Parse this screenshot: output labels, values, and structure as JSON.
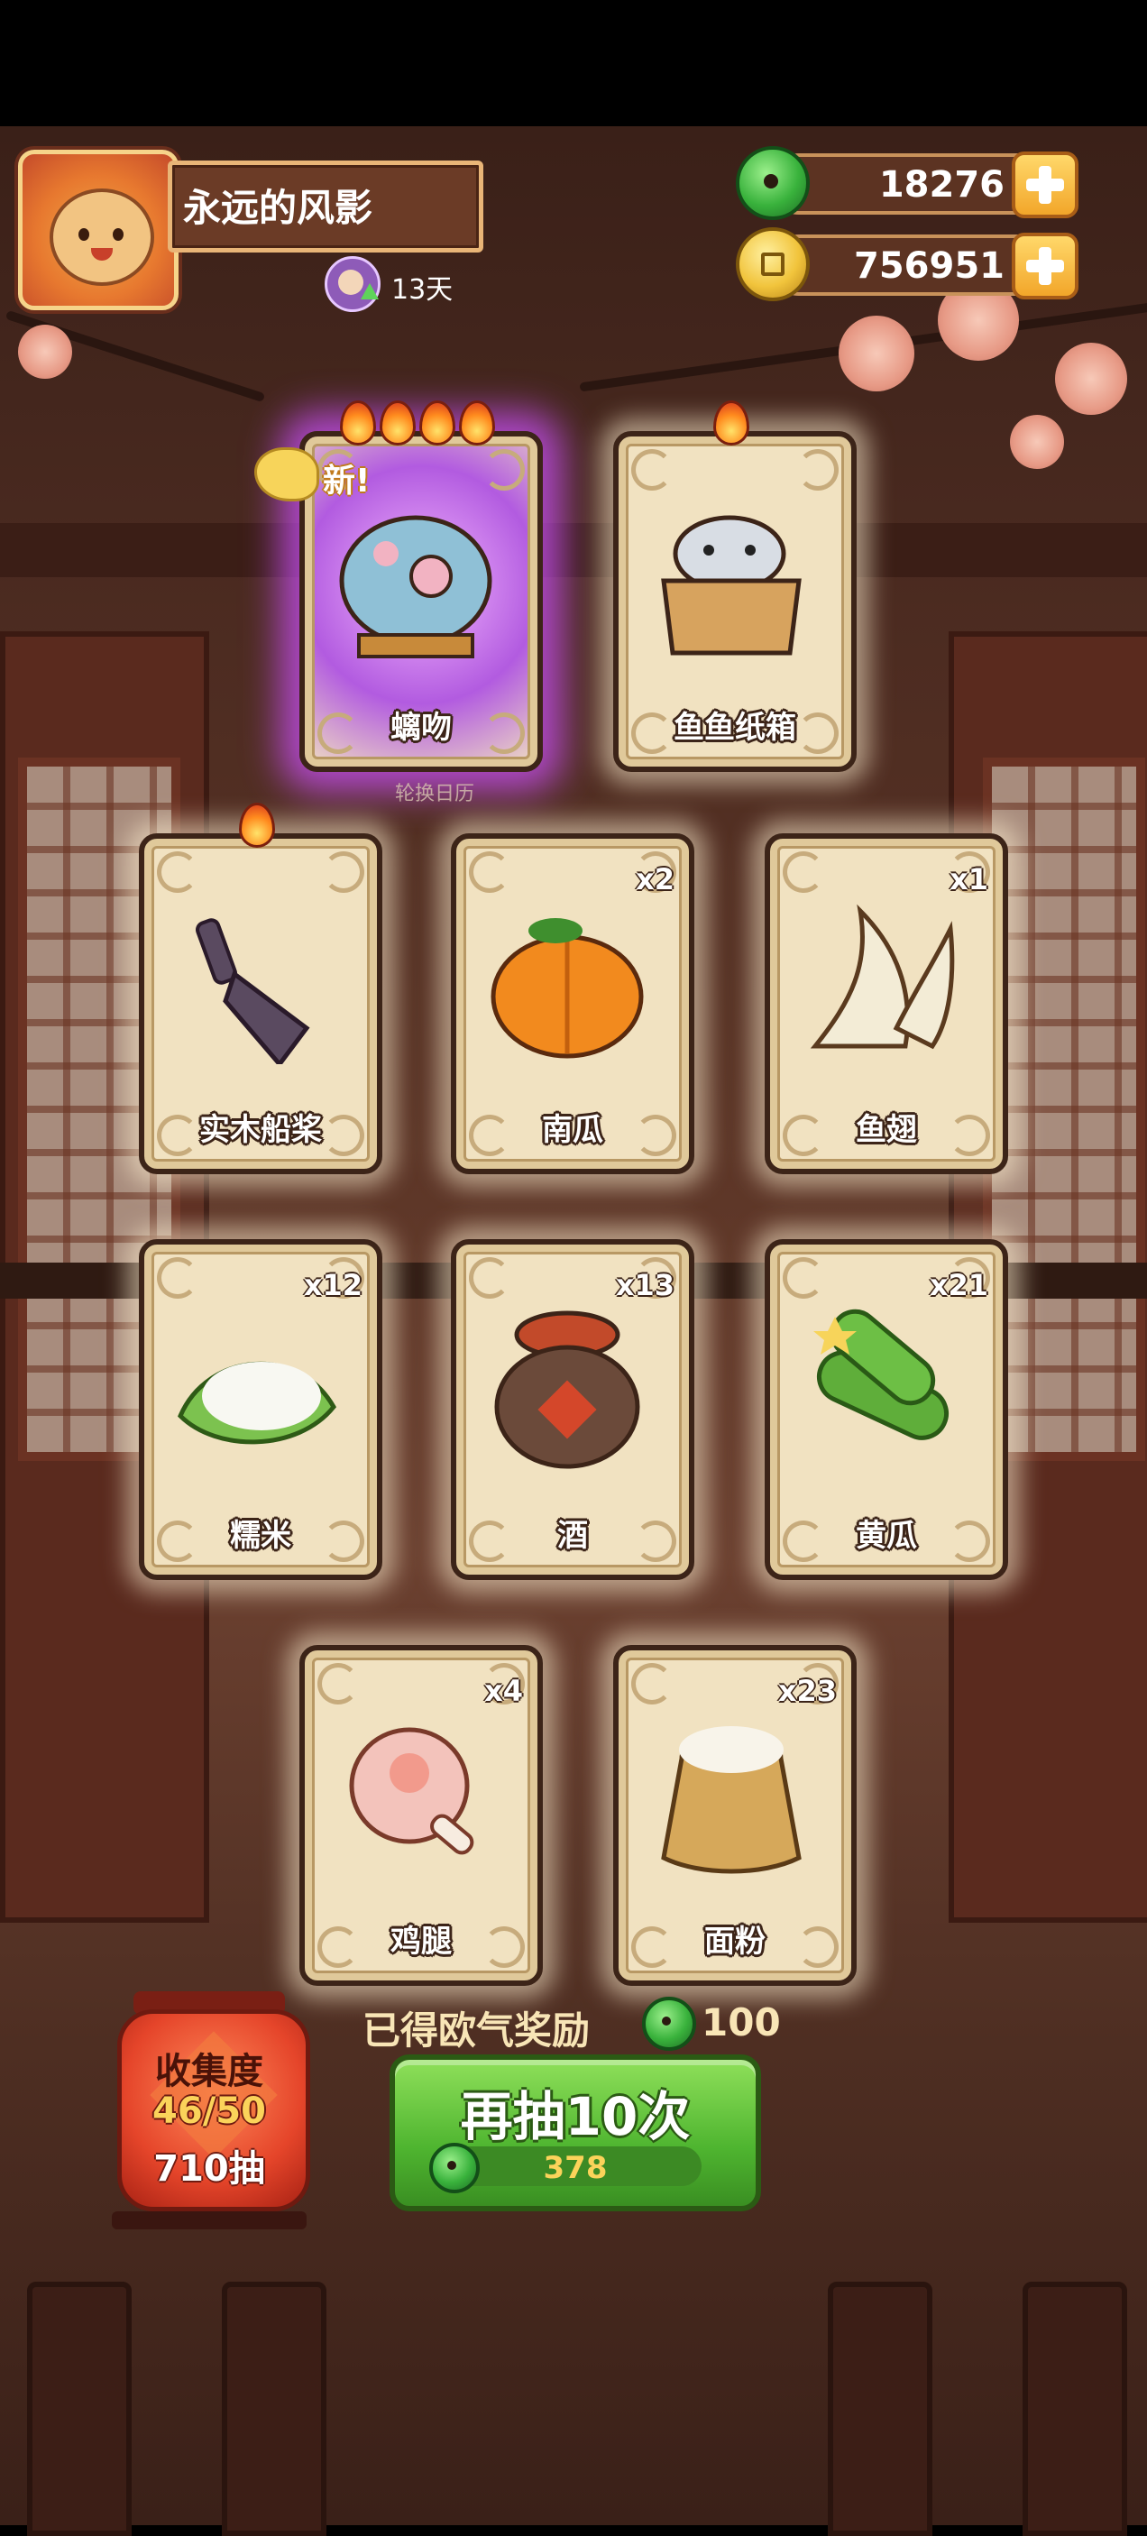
{
  "player": {
    "name": "永远的风影",
    "days": "13天"
  },
  "currency": {
    "jade": "18276",
    "gold": "756951"
  },
  "badges": {
    "new": "新!"
  },
  "calendar_label": "轮换日历",
  "cards": [
    {
      "name": "螭吻",
      "qty": "",
      "flames": 4,
      "rare": true,
      "art": "dragon-fish-icon"
    },
    {
      "name": "鱼鱼纸箱",
      "qty": "",
      "flames": 1,
      "rare": false,
      "art": "seal-in-box-icon"
    },
    {
      "name": "实木船桨",
      "qty": "",
      "flames": 1,
      "rare": false,
      "art": "wooden-oar-icon"
    },
    {
      "name": "南瓜",
      "qty": "x2",
      "flames": 0,
      "rare": false,
      "art": "pumpkin-icon"
    },
    {
      "name": "鱼翅",
      "qty": "x1",
      "flames": 0,
      "rare": false,
      "art": "shark-fin-icon"
    },
    {
      "name": "糯米",
      "qty": "x12",
      "flames": 0,
      "rare": false,
      "art": "sticky-rice-icon"
    },
    {
      "name": "酒",
      "qty": "x13",
      "flames": 0,
      "rare": false,
      "art": "wine-jar-icon"
    },
    {
      "name": "黄瓜",
      "qty": "x21",
      "flames": 0,
      "rare": false,
      "art": "cucumber-icon"
    },
    {
      "name": "鸡腿",
      "qty": "x4",
      "flames": 0,
      "rare": false,
      "art": "chicken-leg-icon"
    },
    {
      "name": "面粉",
      "qty": "x23",
      "flames": 0,
      "rare": false,
      "art": "flour-sack-icon"
    }
  ],
  "reward": {
    "label": "已得欧气奖励",
    "value": "100"
  },
  "collection": {
    "title": "收集度",
    "progress": "46/50",
    "draws": "710抽"
  },
  "draw_button": {
    "label": "再抽10次",
    "cost": "378"
  },
  "colors": {
    "accent_green": "#4fb530",
    "rare_purple": "#b25be0",
    "gold": "#f1c43c"
  }
}
